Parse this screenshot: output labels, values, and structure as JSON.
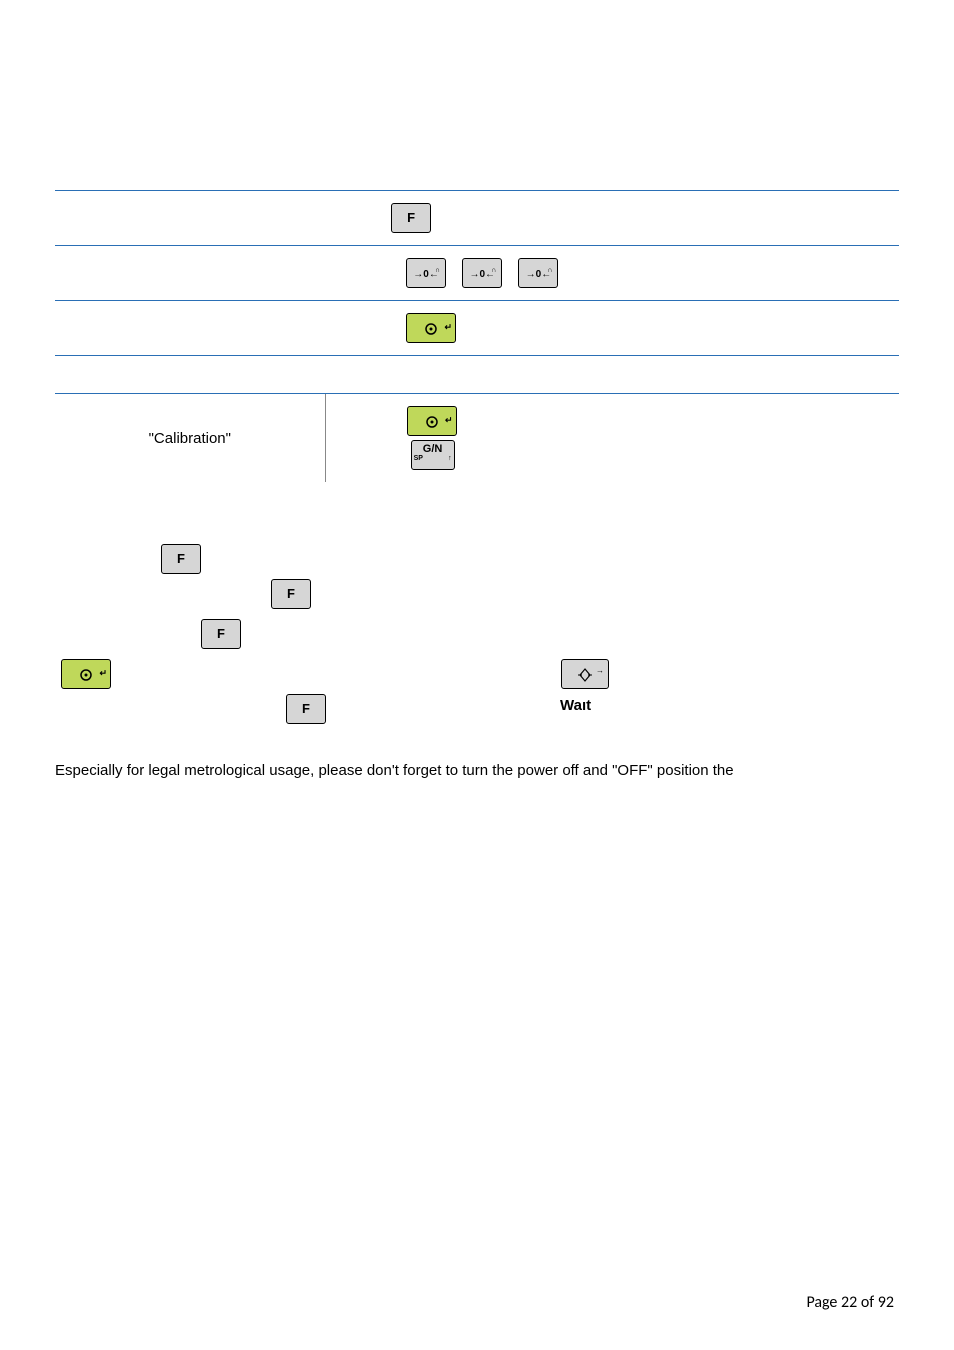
{
  "table": {
    "row5_left": "\"Calibration\""
  },
  "keys": {
    "f": "F",
    "zero_main": "→0←",
    "zero_sub": "∩",
    "gn_top": "G/N",
    "gn_sp": "SP",
    "gn_arrow": "↑"
  },
  "diagram": {
    "wait": "Waıt"
  },
  "body": {
    "text": "Especially for legal metrological usage, please don't forget to turn the power off and \"OFF\" position the"
  },
  "footer": {
    "page": "Page 22 of 92"
  }
}
